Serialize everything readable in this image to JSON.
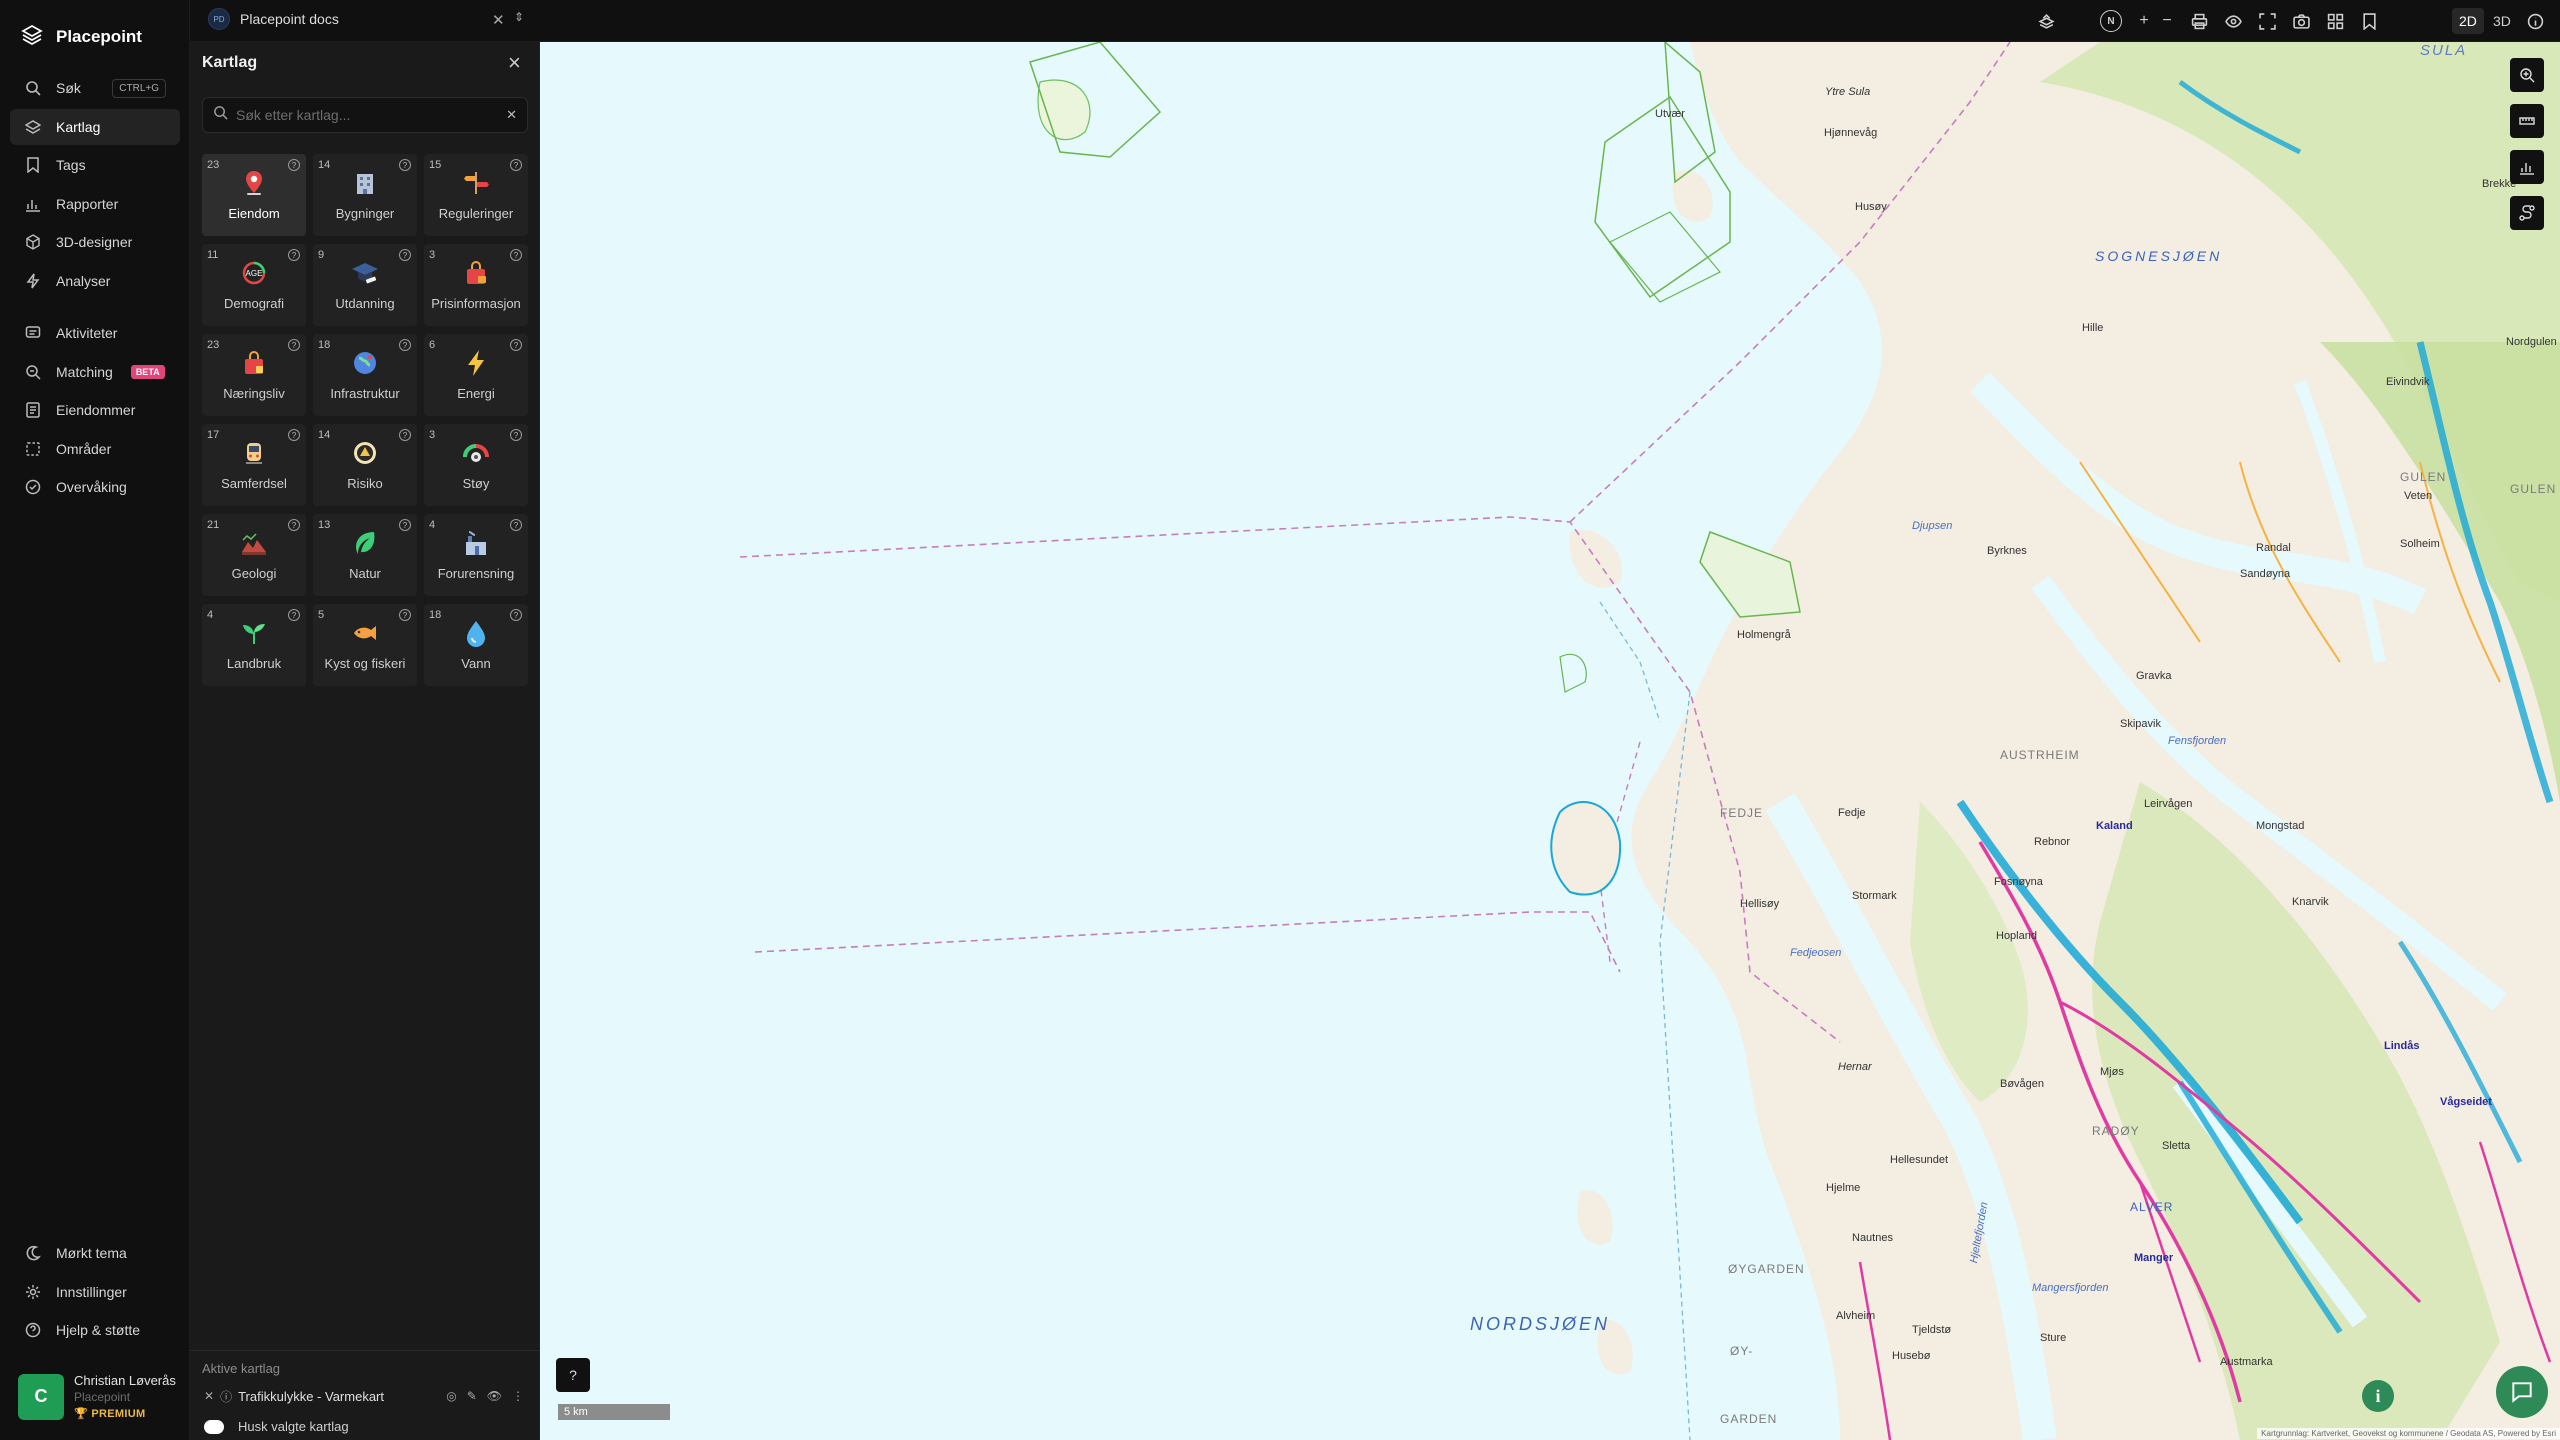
{
  "nav": {
    "brand": "Placepoint",
    "items": [
      {
        "label": "Søk",
        "shortcut": "CTRL+G"
      },
      {
        "label": "Kartlag"
      },
      {
        "label": "Tags"
      },
      {
        "label": "Rapporter"
      },
      {
        "label": "3D-designer"
      },
      {
        "label": "Analyser"
      },
      {
        "label": "Aktiviteter"
      },
      {
        "label": "Matching",
        "badge": "BETA"
      },
      {
        "label": "Eiendommer"
      },
      {
        "label": "Områder"
      },
      {
        "label": "Overvåking"
      }
    ],
    "bottom": [
      {
        "label": "Mørkt tema"
      },
      {
        "label": "Innstillinger"
      },
      {
        "label": "Hjelp & støtte"
      }
    ],
    "user": {
      "initial": "C",
      "name": "Christian Løverås",
      "org": "Placepoint",
      "plan": "PREMIUM"
    }
  },
  "topbar": {
    "workspace_badge": "PD",
    "workspace": "Placepoint docs",
    "north": "N",
    "mode_2d": "2D",
    "mode_3d": "3D"
  },
  "panel": {
    "title": "Kartlag",
    "search_placeholder": "Søk etter kartlag...",
    "categories": [
      {
        "count": "23",
        "label": "Eiendom",
        "icon": "pin-icon"
      },
      {
        "count": "14",
        "label": "Bygninger",
        "icon": "building-icon"
      },
      {
        "count": "15",
        "label": "Reguleringer",
        "icon": "signpost-icon"
      },
      {
        "count": "11",
        "label": "Demografi",
        "icon": "age-icon"
      },
      {
        "count": "9",
        "label": "Utdanning",
        "icon": "graduation-icon"
      },
      {
        "count": "3",
        "label": "Prisinformasjon",
        "icon": "shopping-bag-icon"
      },
      {
        "count": "23",
        "label": "Næringsliv",
        "icon": "bag-icon"
      },
      {
        "count": "18",
        "label": "Infrastruktur",
        "icon": "globe-icon"
      },
      {
        "count": "6",
        "label": "Energi",
        "icon": "lightning-icon"
      },
      {
        "count": "17",
        "label": "Samferdsel",
        "icon": "train-icon"
      },
      {
        "count": "14",
        "label": "Risiko",
        "icon": "hazard-icon"
      },
      {
        "count": "3",
        "label": "Støy",
        "icon": "gauge-icon"
      },
      {
        "count": "21",
        "label": "Geologi",
        "icon": "terrain-icon"
      },
      {
        "count": "13",
        "label": "Natur",
        "icon": "leaf-icon"
      },
      {
        "count": "4",
        "label": "Forurensning",
        "icon": "factory-icon"
      },
      {
        "count": "4",
        "label": "Landbruk",
        "icon": "sprout-icon"
      },
      {
        "count": "5",
        "label": "Kyst og fiskeri",
        "icon": "fish-icon"
      },
      {
        "count": "18",
        "label": "Vann",
        "icon": "drop-icon"
      }
    ],
    "active_title": "Aktive kartlag",
    "active_layer": "Trafikkulykke - Varmekart",
    "remember": "Husk valgte kartlag"
  },
  "map": {
    "labels": {
      "sula": "SULA",
      "sognesjoen": "SOGNESJØEN",
      "nordsjoen": "NORDSJØEN",
      "fedje": "FEDJE",
      "austrheim": "AUSTRHEIM",
      "radoy": "RADØY",
      "alver": "ALVER",
      "gulen": "GULEN",
      "gulen2": "GULEN",
      "oygarden": "ØYGARDEN",
      "oy": "ØY-",
      "garden": "GARDEN",
      "ytre_sula": "Ytre Sula",
      "utvaer": "Utvær",
      "hjonneviy": "Hjønnevåg",
      "husoy": "Husøy",
      "hiles": "Hille",
      "byrknes": "Byrknes",
      "holmengra": "Holmengrå",
      "fedje_town": "Fedje",
      "hellisoy": "Hellisøy",
      "stormark": "Stormark",
      "hernar": "Hernar",
      "hjelme": "Hjelme",
      "nautnes": "Nautnes",
      "alvheim": "Alvheim",
      "tjeldsto": "Tjeldstø",
      "husebo": "Husebø",
      "kaland": "Kaland",
      "mongstad": "Mongstad",
      "lindas": "Lindås",
      "manger": "Manger",
      "knarvik": "Knarvik",
      "fedjeosen": "Fedjeosen",
      "fensfjorden": "Fensfjorden",
      "djupsen": "Djupsen",
      "hellesundet": "Hellesundet",
      "mangersfjorden": "Mangersfjorden",
      "hjeltefjorden": "Hjeltefjorden",
      "sture": "Sture",
      "skipavik": "Skipavik",
      "solheim": "Solheim",
      "rebnor": "Rebnor",
      "eivindvik": "Eivindvik",
      "nordgulen": "Nordgulen",
      "brekke": "Brekke",
      "veten": "Veten",
      "randal": "Randal",
      "sandoyna": "Sandøyna",
      "gravka": "Gravka",
      "fosnoyna": "Fosnøyna",
      "hopland": "Hopland",
      "bovagen": "Bøvågen",
      "vagseidet": "Vågseidet",
      "leirvagen": "Leirvågen",
      "sletta": "Sletta",
      "austmarka": "Austmarka",
      "mjos": "Mjøs"
    },
    "scale": "5 km",
    "attribution": "Kartgrunnlag: Kartverket, Geovekst og kommunene / Geodata AS, Powered by Esri"
  },
  "colors": {
    "accent": "#e0457b",
    "premium": "#e9b949",
    "sea": "#e6fafd",
    "land": "#f3ede2",
    "forest": "#d3e6b1",
    "road": "#e23aa3",
    "water_heat": "#17a7d8"
  }
}
